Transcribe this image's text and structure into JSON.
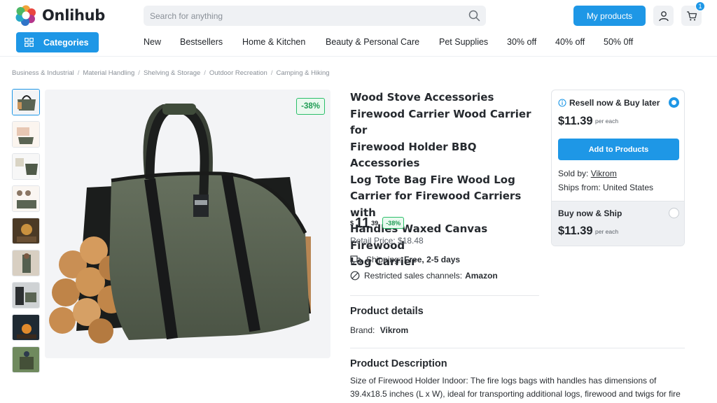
{
  "header": {
    "logo_text": "Onlihub",
    "search_placeholder": "Search for anything",
    "my_products_label": "My products",
    "cart_count": "1",
    "categories_label": "Categories",
    "nav": [
      "New",
      "Bestsellers",
      "Home & Kitchen",
      "Beauty & Personal Care",
      "Pet Supplies",
      "30% off",
      "40% off",
      "50% 0ff"
    ]
  },
  "breadcrumb": [
    "Business & Industrial",
    "Material Handling",
    "Shelving & Storage",
    "Outdoor Recreation",
    "Camping & Hiking"
  ],
  "gallery": {
    "discount_tag": "-38%",
    "thumb_count": 9
  },
  "product": {
    "title_lines": [
      "Wood Stove Accessories",
      "Firewood Carrier Wood Carrier for",
      "Firewood Holder BBQ Accessories",
      "Log Tote Bag Fire Wood Log",
      "Carrier for Firewood Carriers with",
      "Handles Waxed Canvas Firewood",
      "Log Carrier"
    ],
    "price_currency": "$",
    "price_int": "11",
    "price_dec": "39",
    "price_discount": "-38%",
    "retail_price": "Retail Price: $18.48",
    "shipping_label": "Shipping:",
    "shipping_value": "Free, 2-5 days",
    "restricted_label": "Restricted sales channels:",
    "restricted_value": "Amazon",
    "details_heading": "Product details",
    "brand_label": "Brand:",
    "brand_value": "Vikrom",
    "description_heading": "Product Description",
    "description_text": "Size of Firewood Holder Indoor: The fire logs bags with handles has dimensions of 39.4x18.5 inches (L x W), ideal for transporting additional logs, firewood and twigs for fire place. When not in use, this fire wood holder outdoors canvas tote may be hung"
  },
  "buybox": {
    "resell_heading": "Resell now & Buy later",
    "resell_price": "$11.39",
    "resell_per": "per each",
    "add_button": "Add to Products",
    "sold_by_label": "Sold by:",
    "sold_by_value": "Vikrom",
    "ships_from": "Ships from: United States",
    "buy_ship_heading": "Buy now & Ship",
    "buy_ship_price": "$11.39",
    "buy_ship_per": "per each"
  },
  "colors": {
    "accent": "#1e97e6",
    "discount_green": "#1f9c54",
    "bag_canvas": "#5a6453"
  }
}
